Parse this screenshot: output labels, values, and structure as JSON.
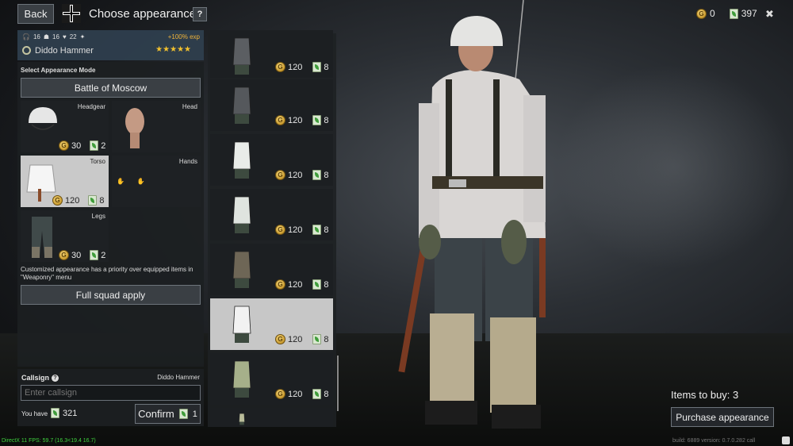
{
  "topbar": {
    "back_label": "Back",
    "title": "Choose appearance",
    "help_label": "?",
    "gold": "0",
    "tickets": "397",
    "close_label": "✖"
  },
  "soldier": {
    "stats": [
      "16",
      "16",
      "22"
    ],
    "exp_bonus": "+100% exp",
    "name": "Diddo Hammer",
    "stars": "★★★★★"
  },
  "mode": {
    "section_label": "Select Appearance Mode",
    "selected": "Battle of Moscow"
  },
  "slots": [
    {
      "label": "Headgear",
      "gold": "30",
      "tickets": "2"
    },
    {
      "label": "Head"
    },
    {
      "label": "Torso",
      "gold": "120",
      "tickets": "8"
    },
    {
      "label": "Hands"
    },
    {
      "label": "Legs",
      "gold": "30",
      "tickets": "2"
    }
  ],
  "note": "Customized appearance has a priority over equipped items in \"Weaponry\" menu",
  "squad_button": "Full squad apply",
  "callsign": {
    "label": "Callsign",
    "help": "?",
    "current_name": "Diddo Hammer",
    "placeholder": "Enter callsign",
    "you_have_label": "You have",
    "you_have_value": "321",
    "confirm_label": "Confirm",
    "confirm_cost": "1"
  },
  "items": [
    {
      "gold": "120",
      "tickets": "8",
      "color": "#5b5e62"
    },
    {
      "gold": "120",
      "tickets": "8",
      "color": "#55585c"
    },
    {
      "gold": "120",
      "tickets": "8",
      "color": "#e9ece9"
    },
    {
      "gold": "120",
      "tickets": "8",
      "color": "#dfe4df"
    },
    {
      "gold": "120",
      "tickets": "8",
      "color": "#6e6656"
    },
    {
      "gold": "120",
      "tickets": "8",
      "color": "#f2f2f2"
    },
    {
      "gold": "120",
      "tickets": "8",
      "color": "#a6b08a"
    },
    {
      "gold": "",
      "tickets": "",
      "color": "#b9bc9a"
    }
  ],
  "purchase": {
    "items_to_buy": "Items to buy: 3",
    "button": "Purchase appearance"
  },
  "debug": {
    "fps": "DirectX 11 FPS: 59.7 (16.3<19.4 16.7)",
    "build": "build: 6889 version: 0.7.0.282 call"
  }
}
